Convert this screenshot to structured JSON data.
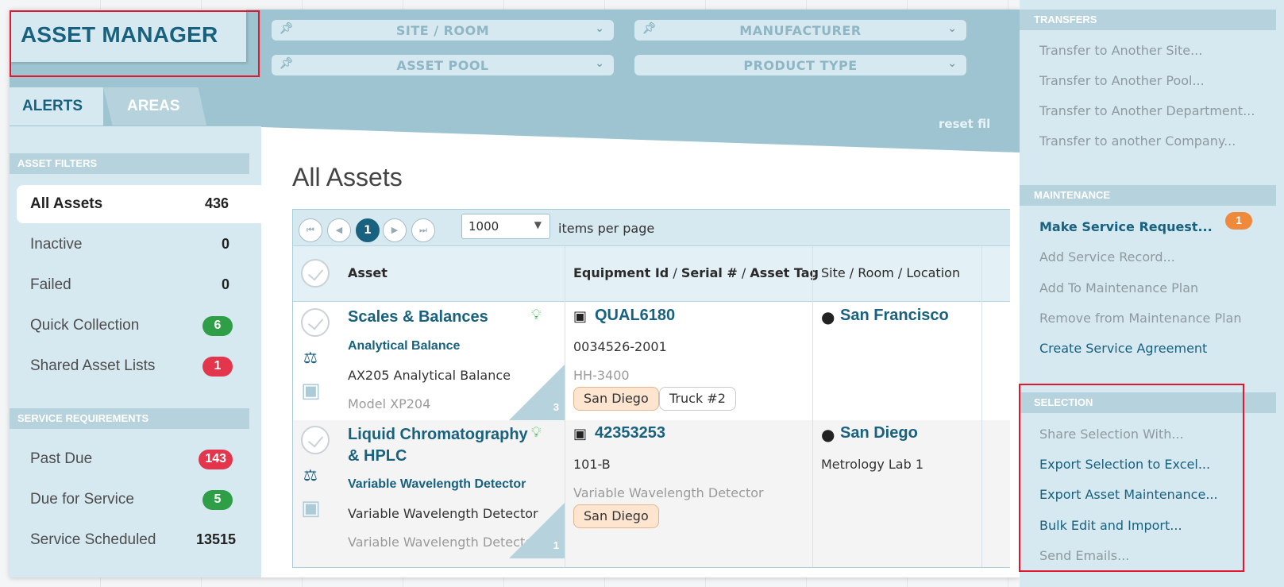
{
  "header": {
    "app_title": "ASSET MANAGER",
    "filters": [
      {
        "label": "SITE / ROOM"
      },
      {
        "label": "MANUFACTURER"
      },
      {
        "label": "ASSET POOL"
      },
      {
        "label": "PRODUCT TYPE"
      }
    ],
    "reset_label": "reset fil"
  },
  "tabs": {
    "alerts": "ALERTS",
    "areas": "AREAS"
  },
  "sidebar": {
    "asset_filters_heading": "ASSET FILTERS",
    "asset_filters": [
      {
        "label": "All Assets",
        "count": "436"
      },
      {
        "label": "Inactive",
        "count": "0"
      },
      {
        "label": "Failed",
        "count": "0"
      },
      {
        "label": "Quick Collection",
        "count": "6"
      },
      {
        "label": "Shared Asset Lists",
        "count": "1"
      }
    ],
    "service_heading": "SERVICE REQUIREMENTS",
    "service": [
      {
        "label": "Past Due",
        "count": "143"
      },
      {
        "label": "Due for Service",
        "count": "5"
      },
      {
        "label": "Service Scheduled",
        "count": "13515"
      }
    ]
  },
  "main": {
    "title": "All Assets",
    "pager": {
      "current_page": "1",
      "page_size": "1000",
      "items_label": "items per page"
    },
    "columns": {
      "asset": "Asset",
      "equip_a": "Equipment Id",
      "sep1": " / ",
      "equip_b": "Serial #",
      "sep2": " / ",
      "equip_c": "Asset Tag",
      "site": "Site / Room / Location"
    },
    "rows": [
      {
        "name": "Scales & Balances",
        "type": "Analytical Balance",
        "desc": "AX205 Analytical Balance",
        "model": "Model XP204",
        "corner_count": "3",
        "equipment_id": "QUAL6180",
        "serial": "0034526-2001",
        "asset_tag": "HH-3400",
        "tags": [
          "San Diego",
          "Truck #2"
        ],
        "site": "San Francisco",
        "room": ""
      },
      {
        "name": "Liquid Chromatography & HPLC",
        "type": "Variable Wavelength Detector",
        "desc": "Variable Wavelength Detector",
        "model": "Variable Wavelength Detector",
        "corner_count": "1",
        "equipment_id": "42353253",
        "serial": "101-B",
        "asset_tag": "Variable Wavelength Detector",
        "tags": [
          "San Diego"
        ],
        "site": "San Diego",
        "room": "Metrology Lab 1"
      }
    ]
  },
  "right_panel": {
    "transfers_heading": "TRANSFERS",
    "transfers": [
      "Transfer to Another Site...",
      "Transfer to Another Pool...",
      "Transfer to Another Department...",
      "Transfer to another Company..."
    ],
    "maintenance_heading": "MAINTENANCE",
    "maintenance": [
      "Make Service Request...",
      "Add Service Record...",
      "Add To Maintenance Plan",
      "Remove from Maintenance Plan",
      "Create Service Agreement"
    ],
    "service_request_badge": "1",
    "selection_heading": "SELECTION",
    "selection": [
      "Share Selection With...",
      "Export Selection to Excel...",
      "Export Asset Maintenance...",
      "Bulk Edit and Import...",
      "Send Emails..."
    ]
  },
  "colors": {
    "brand": "#18617f",
    "band": "#9fc4d1",
    "panel": "#d6e9f0",
    "green": "#2e9e47",
    "red": "#e3354b",
    "orange": "#ef8a3c",
    "annotation": "#e2172d"
  },
  "icons": [
    "pin-icon",
    "chevron-down-icon",
    "lightbulb-icon",
    "box-icon",
    "map-pin-icon",
    "scale-icon",
    "cubes-icon",
    "check-circle-icon"
  ]
}
